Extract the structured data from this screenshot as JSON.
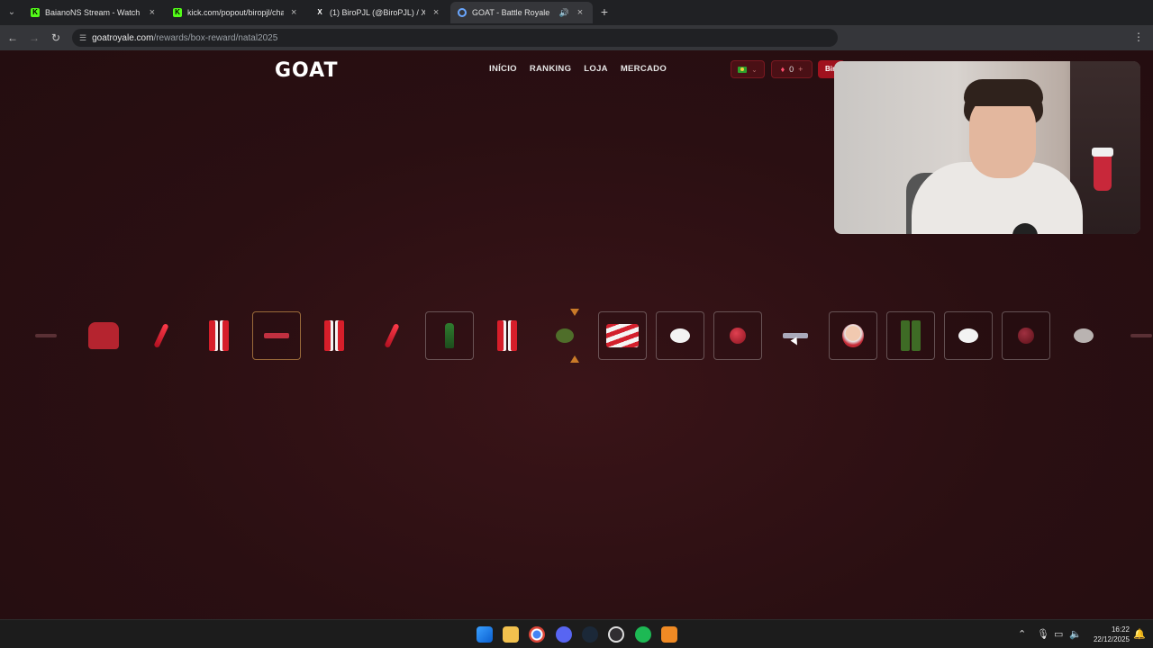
{
  "browser": {
    "tabs": [
      {
        "title": "BaianoNS Stream - Watch Live",
        "favicon": "kick-icon",
        "active": false
      },
      {
        "title": "kick.com/popout/biropjl/chat",
        "favicon": "kick-icon",
        "active": false
      },
      {
        "title": "(1) BiroPJL (@BiroPJL) / X",
        "favicon": "x-icon",
        "active": false
      },
      {
        "title": "GOAT - Battle Royale",
        "favicon": "goat-icon",
        "active": true
      }
    ],
    "address": {
      "domain": "goatroyale.com",
      "path": "/rewards/box-reward/natal2025"
    }
  },
  "site": {
    "logo": "GOAT",
    "nav": [
      "INÍCIO",
      "RANKING",
      "LOJA",
      "MERCADO"
    ],
    "gems_count": "0",
    "user_label": "Bir",
    "colors": {
      "accent": "#a0121e",
      "marker": "#c97a28",
      "background": "#2a0f12"
    }
  },
  "roulette": {
    "items": [
      {
        "kind": "faint",
        "framed": false
      },
      {
        "kind": "shirt",
        "framed": false
      },
      {
        "kind": "bat",
        "framed": false
      },
      {
        "kind": "pants",
        "framed": false
      },
      {
        "kind": "gun",
        "framed": true,
        "highlight": true
      },
      {
        "kind": "pants",
        "framed": false
      },
      {
        "kind": "bat",
        "framed": false
      },
      {
        "kind": "bottle",
        "framed": true
      },
      {
        "kind": "pants",
        "framed": false
      },
      {
        "kind": "grenade",
        "framed": false
      },
      {
        "kind": "flag",
        "framed": true
      },
      {
        "kind": "egg",
        "framed": true
      },
      {
        "kind": "ball",
        "framed": true
      },
      {
        "kind": "gun-grey",
        "framed": false
      },
      {
        "kind": "santa",
        "framed": true
      },
      {
        "kind": "pants-green",
        "framed": true
      },
      {
        "kind": "egg",
        "framed": true
      },
      {
        "kind": "ball-dim",
        "framed": true
      },
      {
        "kind": "egg-dim",
        "framed": false
      },
      {
        "kind": "faint",
        "framed": false
      }
    ]
  },
  "taskbar": {
    "apps": [
      "windows-start-icon",
      "file-explorer-icon",
      "chrome-icon",
      "discord-icon",
      "steam-icon",
      "obs-icon",
      "spotify-icon",
      "app-icon"
    ],
    "time": "16:22",
    "date": "22/12/2025"
  }
}
